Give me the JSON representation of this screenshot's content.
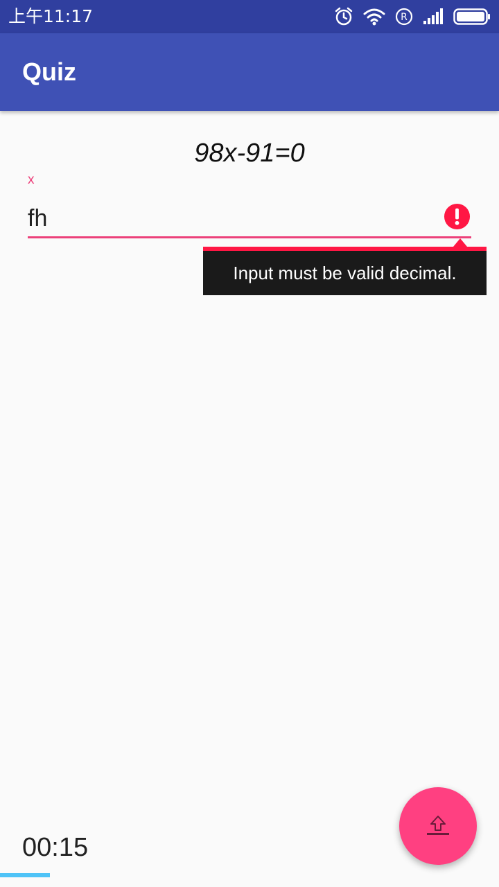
{
  "status_bar": {
    "time": "上午11:17",
    "icons": [
      "alarm-icon",
      "wifi-icon",
      "roaming-icon",
      "signal-icon",
      "battery-icon"
    ],
    "color": "#303f9f"
  },
  "app_bar": {
    "title": "Quiz",
    "color": "#3f51b5"
  },
  "question": {
    "equation": "98x-91=0"
  },
  "answer_field": {
    "label": "x",
    "value": "fh",
    "error_icon": "error-icon",
    "accent_color": "#ec407a"
  },
  "error_popup": {
    "message": "Input must be valid decimal.",
    "color": "#ff1744"
  },
  "timer": {
    "value": "00:15",
    "progress_fraction": 0.1,
    "progress_color": "#4fc3f7"
  },
  "fab": {
    "icon": "upload-icon",
    "color": "#ff4081"
  }
}
